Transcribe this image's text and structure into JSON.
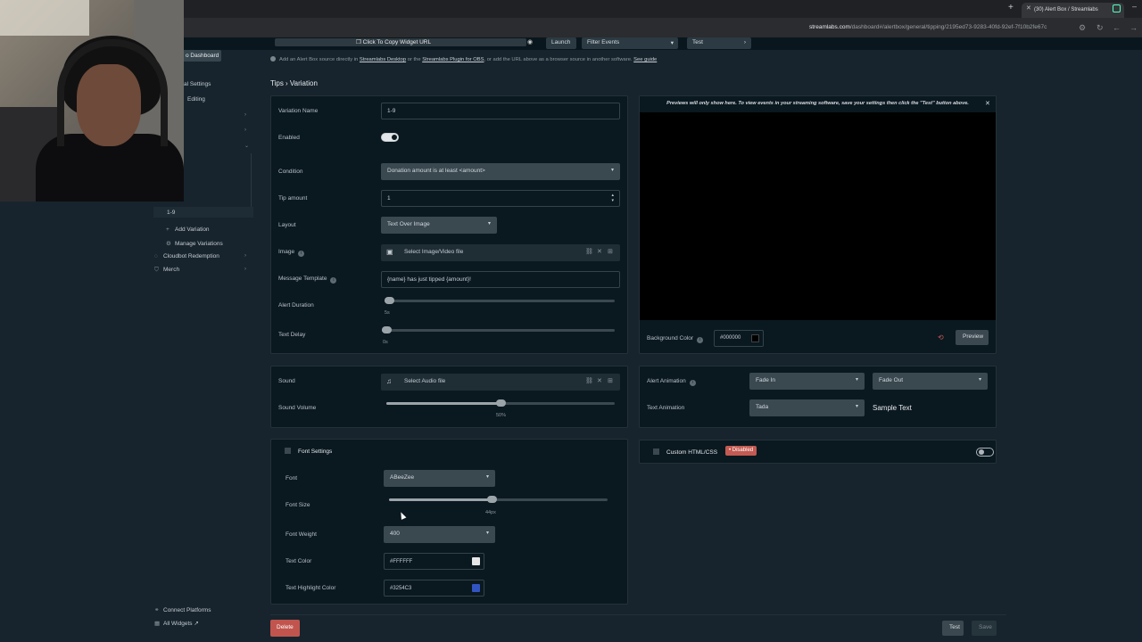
{
  "browser": {
    "tab_title": "(30) Alert Box / Streamlabs",
    "url_host": "streamlabs.com",
    "url_path": "/dashboard#/alertbox/general/tipping/2195ed73-9283-40fd-92ef-7f10b2fe67c"
  },
  "widget_bar": {
    "copy_url": "Click To Copy Widget URL",
    "launch": "Launch",
    "filter_events": "Filter Events",
    "test": "Test"
  },
  "info": {
    "prefix": "Add an Alert Box source directly in",
    "link1": "Streamlabs Desktop",
    "mid": "or the",
    "link2": "Streamlabs Plugin for OBS",
    "suffix": ", or add the URL above as a browser source in another software.",
    "link3": "See guide"
  },
  "sidebar": {
    "dashboard": "o Dashboard",
    "general_settings": "al Settings",
    "editing": "Editing",
    "variation_active": "1-9",
    "add_variation": "Add Variation",
    "manage_variations": "Manage Variations",
    "cloudbot": "Cloudbot Redemption",
    "merch": "Merch",
    "connect_platforms": "Connect Platforms",
    "all_widgets": "All Widgets"
  },
  "breadcrumb": "Tips › Variation",
  "form": {
    "variation_name_label": "Variation Name",
    "variation_name_value": "1-9",
    "enabled_label": "Enabled",
    "condition_label": "Condition",
    "condition_value": "Donation amount is at least <amount>",
    "tip_amount_label": "Tip amount",
    "tip_amount_value": "1",
    "layout_label": "Layout",
    "layout_value": "Text Over Image",
    "image_label": "Image",
    "image_value": "Select Image/Video file",
    "message_template_label": "Message Template",
    "message_template_value": "{name} has just tipped {amount}!",
    "alert_duration_label": "Alert Duration",
    "alert_duration_value": "5s",
    "alert_duration_fraction": 0.02,
    "text_delay_label": "Text Delay",
    "text_delay_value": "0s",
    "text_delay_fraction": 0.0
  },
  "sound": {
    "sound_label": "Sound",
    "sound_value": "Select Audio file",
    "volume_label": "Sound Volume",
    "volume_value": "50%",
    "volume_fraction": 0.5
  },
  "font": {
    "section_title": "Font Settings",
    "font_label": "Font",
    "font_value": "ABeeZee",
    "size_label": "Font Size",
    "size_value": "44px",
    "size_fraction": 0.47,
    "weight_label": "Font Weight",
    "weight_value": "400",
    "text_color_label": "Text Color",
    "text_color_value": "#FFFFFF",
    "highlight_label": "Text Highlight Color",
    "highlight_value": "#3254C3"
  },
  "preview": {
    "note": "Previews will only show here. To view events in your streaming software, save your settings then click the \"Test\" button above.",
    "bg_label": "Background Color",
    "bg_value": "#000000",
    "preview_btn": "Preview"
  },
  "animation": {
    "alert_label": "Alert Animation",
    "in_value": "Fade In",
    "out_value": "Fade Out",
    "text_label": "Text Animation",
    "text_value": "Tada",
    "sample_text": "Sample Text"
  },
  "custom": {
    "label": "Custom HTML/CSS",
    "badge": "• Disabled"
  },
  "footer": {
    "delete": "Delete",
    "test": "Test",
    "save": "Save"
  }
}
